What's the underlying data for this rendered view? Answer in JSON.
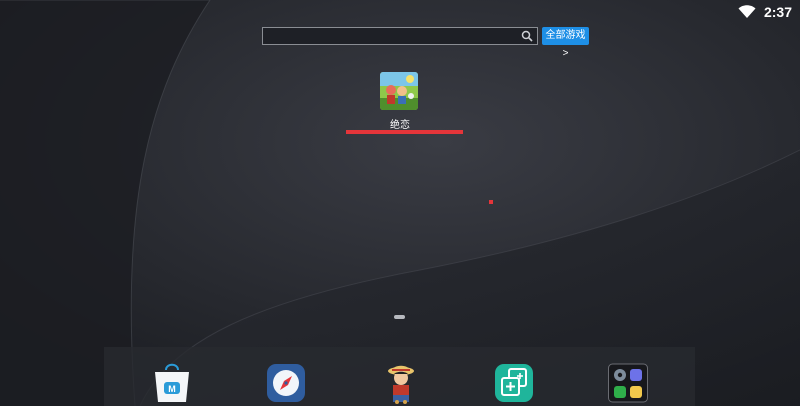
{
  "status_bar": {
    "time": "2:37",
    "wifi_icon": "wifi-icon"
  },
  "search": {
    "value": "",
    "placeholder": "",
    "icon": "search-icon"
  },
  "all_games_button": {
    "label": "全部游戏 >",
    "color": "#1e8fe6"
  },
  "downloading_app": {
    "name": "绝恋",
    "progress": 1.0,
    "progress_color": "#e5353a"
  },
  "home_screens": {
    "pages": 1,
    "current": 1
  },
  "dock": {
    "items": [
      {
        "name": "market-app",
        "icon": "market-bag-icon"
      },
      {
        "name": "browser-app",
        "icon": "compass-icon"
      },
      {
        "name": "one-piece-game",
        "icon": "luffy-icon"
      },
      {
        "name": "app-cloner",
        "icon": "multi-add-icon"
      },
      {
        "name": "tools-folder",
        "icon": "folder-grid-icon"
      }
    ]
  }
}
